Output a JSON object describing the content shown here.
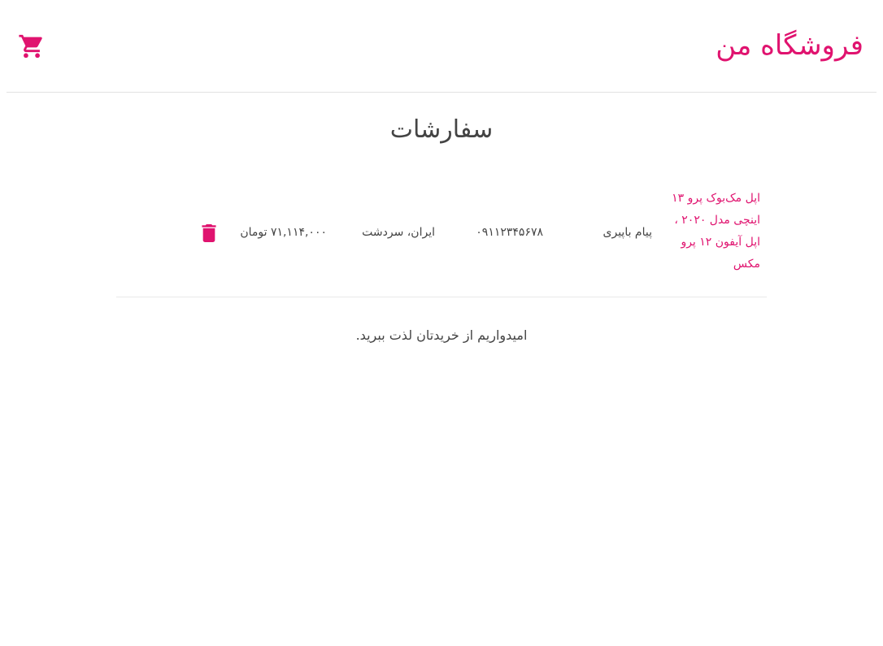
{
  "header": {
    "brand": "فروشگاه من",
    "cart_icon": "shopping-cart-icon"
  },
  "page": {
    "title": "سفارشات"
  },
  "orders": [
    {
      "products": "اپل مک‌بوک پرو ۱۳ اینچی مدل ۲۰۲۰ ، اپل آیفون ۱۲ پرو مکس",
      "customer_name": "پیام باپیری",
      "phone": "۰۹۱۱۲۳۴۵۶۷۸",
      "address": "ایران، سردشت",
      "total": "۷۱,۱۱۴,۰۰۰ تومان",
      "delete_icon": "trash-icon"
    }
  ],
  "footer": {
    "message": "امیدواریم از خریدتان لذت ببرید."
  },
  "colors": {
    "accent": "#e0136f",
    "text": "#444444",
    "divider": "#e2e2e2"
  }
}
